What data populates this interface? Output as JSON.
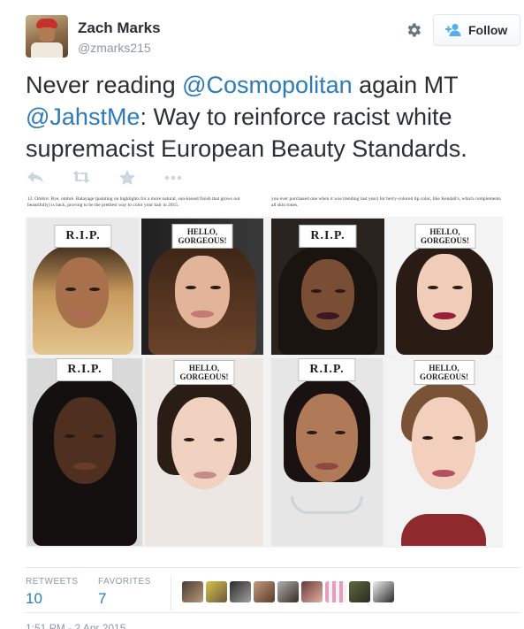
{
  "author": {
    "name": "Zach Marks",
    "handle": "@zmarks215",
    "avatar_icon": "profile-photo"
  },
  "header": {
    "settings_icon": "gear-icon",
    "follow_label": "Follow",
    "follow_icon": "add-user-icon"
  },
  "tweet": {
    "text_part1": "Never reading ",
    "mention1": "@Cosmopolitan",
    "text_part2": " again MT ",
    "mention2": "@JahstMe",
    "text_part3": ": Way to reinforce racist white supremacist European Beauty Standards."
  },
  "actions": {
    "reply_icon": "reply-icon",
    "retweet_icon": "retweet-icon",
    "favorite_icon": "star-icon",
    "more_icon": "more-icon"
  },
  "media": {
    "caption_left": "12. Ombré: Bye, ombré. Balayage (painting on highlights for a more natural, sun-kissed finish that grows out beautifully) is back, proving to be the prettiest way to color your hair in 2015.",
    "caption_right": "you ever purchased one when it was trending last year) for berry-colored lip color, like Kendall's, which complements all skin tones.",
    "labels": {
      "rip": "R.I.P.",
      "hello_line1": "HELLO,",
      "hello_line2": "GORGEOUS!"
    }
  },
  "stats": {
    "retweets_label": "RETWEETS",
    "retweets_value": "10",
    "favorites_label": "FAVORITES",
    "favorites_value": "7"
  },
  "timestamp": "1:51 PM - 2 Apr 2015",
  "colors": {
    "link": "#2b7bb9",
    "text": "#292f33",
    "muted": "#8899a6",
    "border": "#e1e8ed"
  }
}
